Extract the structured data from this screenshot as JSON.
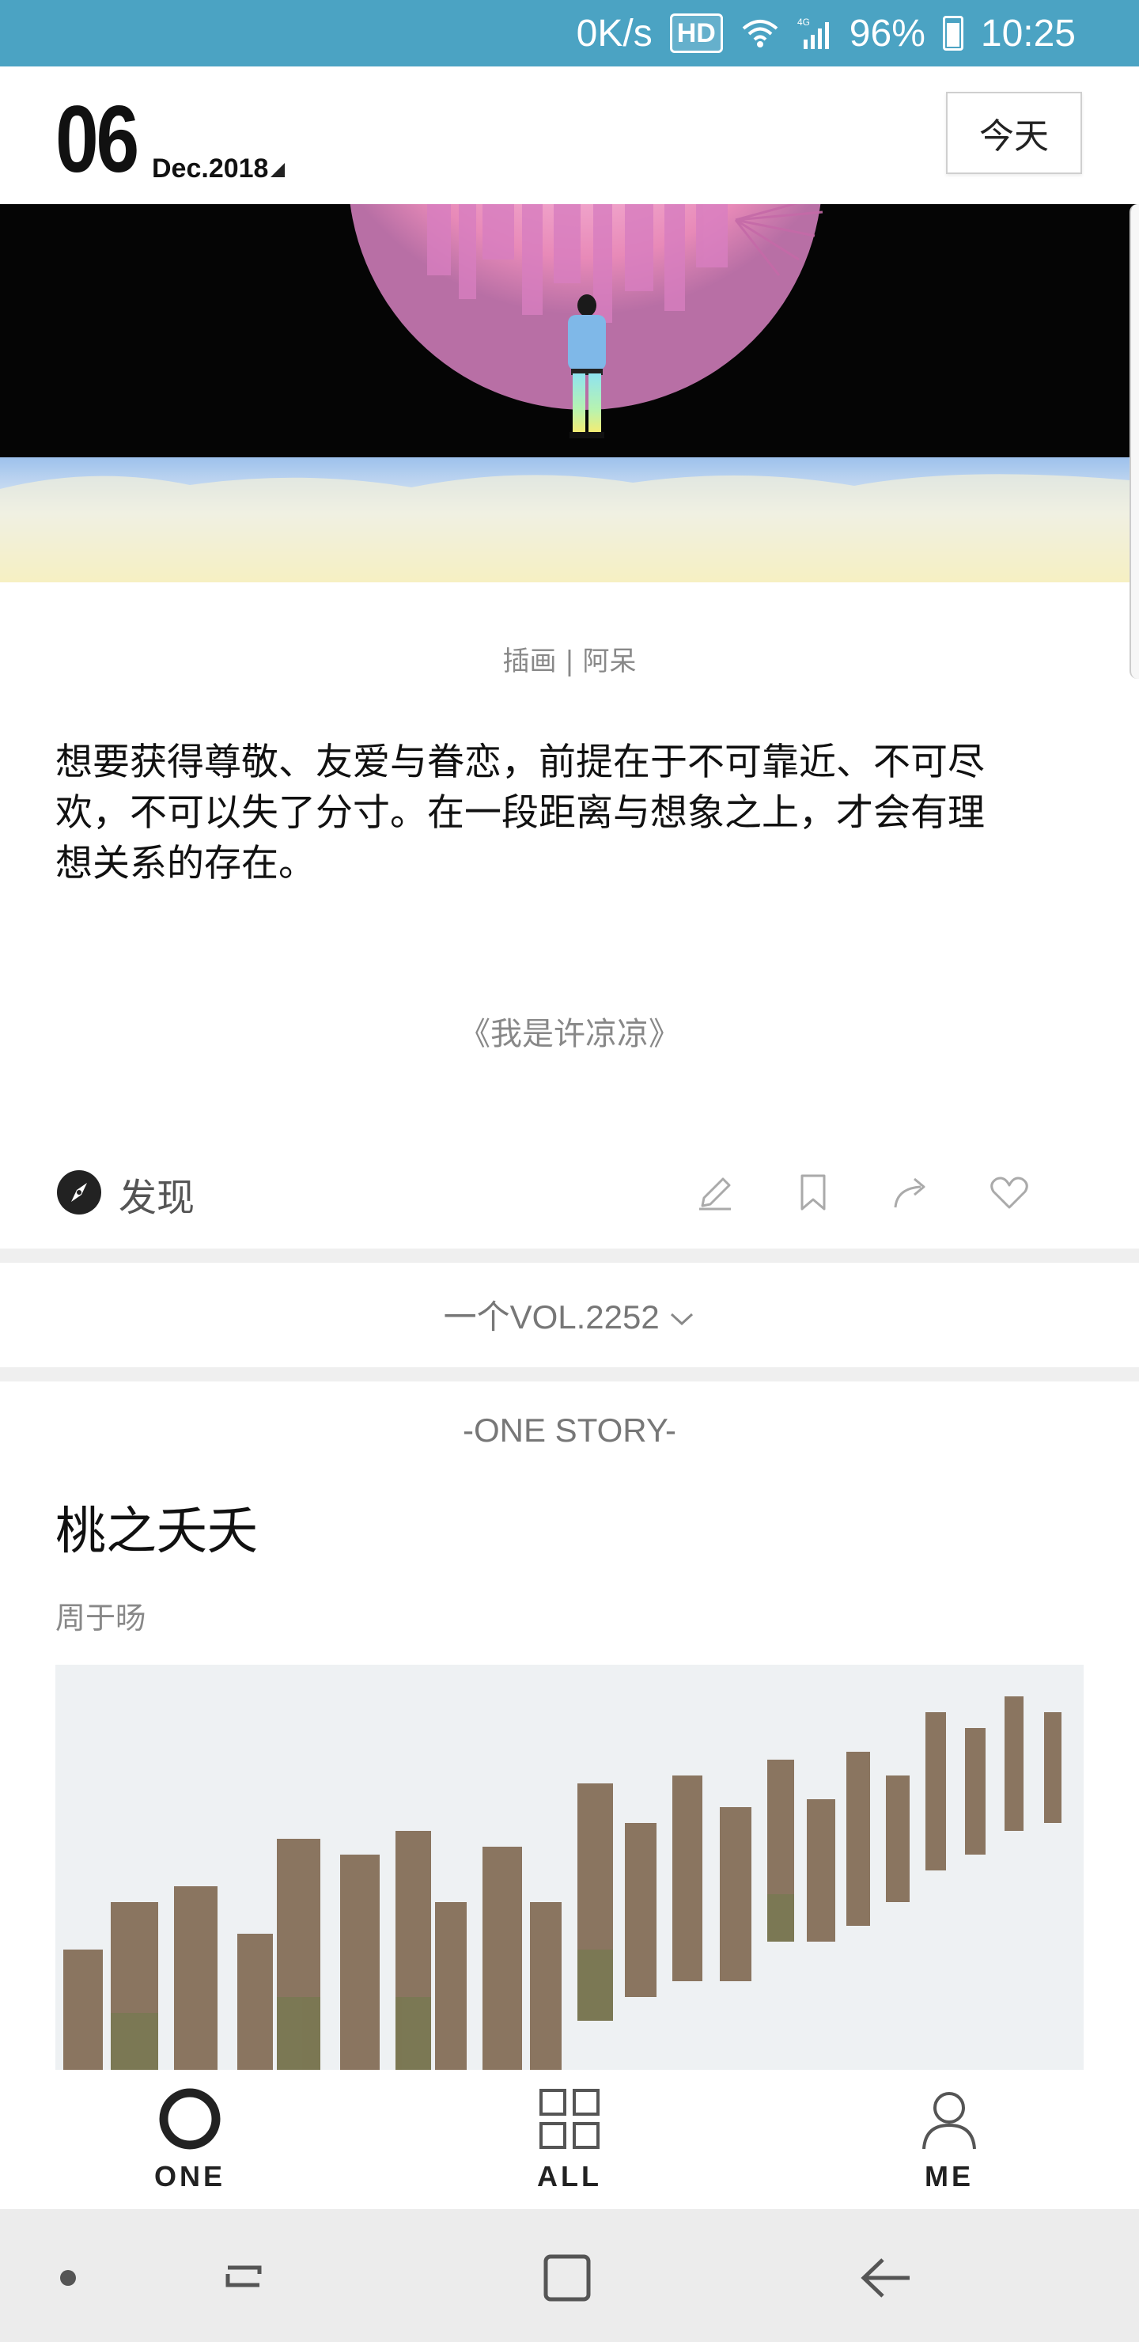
{
  "status_bar": {
    "speed": "0K/s",
    "hd": "HD",
    "network": "4G",
    "battery": "96%",
    "time": "10:25",
    "bg_color": "#4ba3c3"
  },
  "header": {
    "day": "06",
    "month_year": "Dec.2018",
    "today_label": "今天"
  },
  "illustration": {
    "caption": "插画 | 阿呆"
  },
  "quote": {
    "text": "想要获得尊敬、友爱与眷恋，前提在于不可靠近、不可尽欢，不可以失了分寸。在一段距离与想象之上，才会有理想关系的存在。",
    "source": "《我是许凉凉》"
  },
  "actions": {
    "discover_label": "发现",
    "icons": [
      "pencil-icon",
      "bookmark-icon",
      "share-icon",
      "heart-icon"
    ]
  },
  "volume": {
    "label": "一个VOL.2252"
  },
  "story": {
    "tag": "-ONE STORY-",
    "title": "桃之夭夭",
    "author": "周于旸"
  },
  "tabs": [
    {
      "label": "ONE",
      "icon": "circle-icon"
    },
    {
      "label": "ALL",
      "icon": "grid-icon"
    },
    {
      "label": "ME",
      "icon": "person-icon"
    }
  ],
  "nav": [
    "dot-icon",
    "recents-icon",
    "home-icon",
    "back-icon"
  ]
}
